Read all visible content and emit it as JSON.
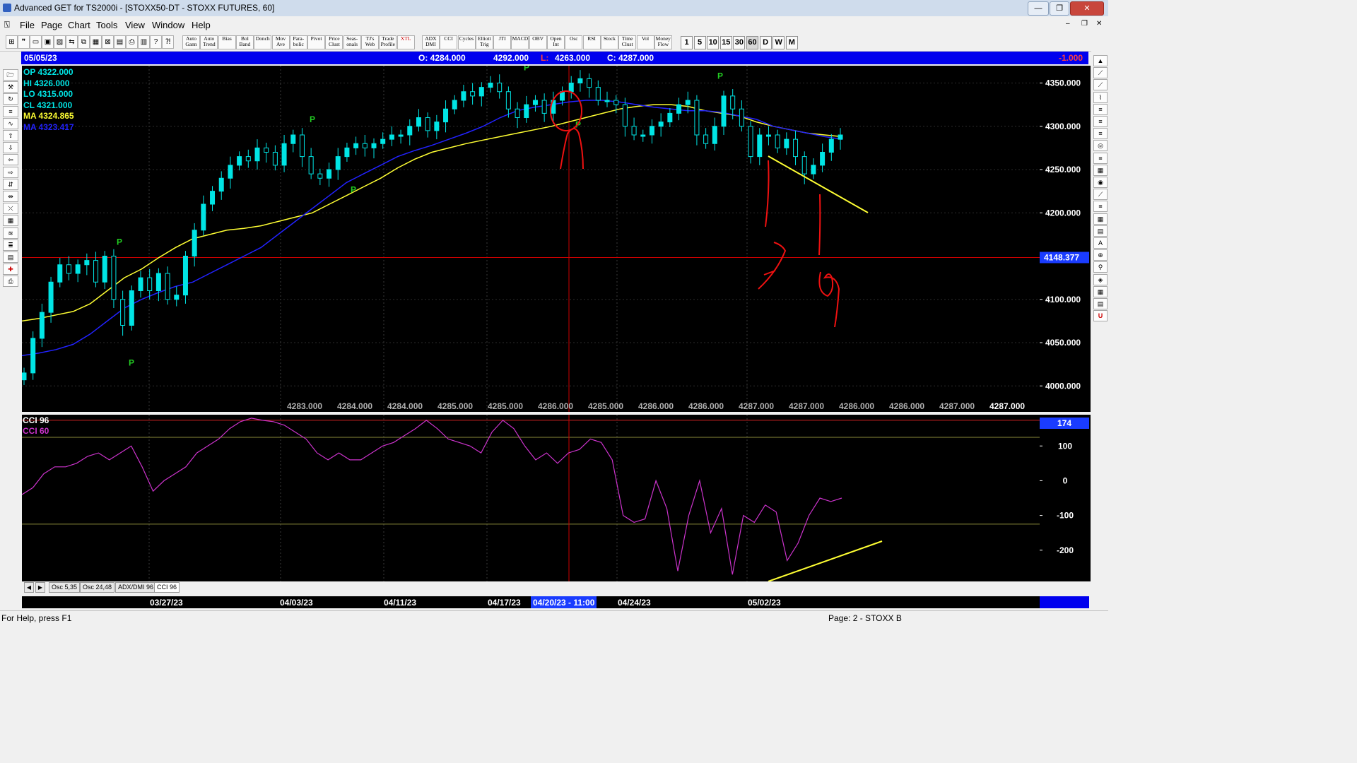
{
  "window": {
    "title": "Advanced GET for TS2000i - [STOXX50-DT - STOXX FUTURES, 60]",
    "min": "—",
    "max": "❐",
    "close": "✕"
  },
  "menu": [
    "File",
    "Page",
    "Chart",
    "Tools",
    "View",
    "Window",
    "Help"
  ],
  "toolbar": {
    "studies": [
      "Auto Gann",
      "Auto Trend",
      "Bias",
      "Bol Band",
      "Donch",
      "Mov Ave",
      "Para-bolic",
      "Pivot",
      "Price Clust",
      "Seas-onals",
      "TJ's Web",
      "Trade Profile",
      "XTL",
      "ADX DMI",
      "CCI",
      "Cycles",
      "Elliott Trig",
      "JTI",
      "MACD",
      "OBV",
      "Open Int",
      "Osc",
      "RSI",
      "Stock",
      "Time Clust",
      "Vol",
      "Money Flow"
    ],
    "intervals": [
      "1",
      "5",
      "10",
      "15",
      "30",
      "60",
      "D",
      "W",
      "M"
    ]
  },
  "header": {
    "date": "05/05/23",
    "open": "O: 4284.000",
    "high": "4292.000",
    "low_prefix": "L:",
    "low": "4263.000",
    "close": "C: 4287.000",
    "change": "-1.000"
  },
  "readout": {
    "op": "OP  4322.000",
    "hi": "HI   4326.000",
    "lo": "LO  4315.000",
    "cl": "CL  4321.000",
    "ma1": "MA  4324.865",
    "ma2": "MA  4323.417"
  },
  "price_axis": {
    "ticks": [
      "4350.000",
      "4300.000",
      "4250.000",
      "4200.000",
      "4100.000",
      "4050.000",
      "4000.000"
    ],
    "cursor_price": "4148.377"
  },
  "bottom_values": [
    "4283.000",
    "4284.000",
    "4284.000",
    "4285.000",
    "4285.000",
    "4286.000",
    "4285.000",
    "4286.000",
    "4286.000",
    "4287.000",
    "4287.000",
    "4286.000",
    "4286.000",
    "4287.000",
    "4287.000"
  ],
  "pivot_marker": "P",
  "osc": {
    "label1": "CCI 96",
    "label2": "CCI  60",
    "current": "174",
    "ticks": [
      "100",
      "0",
      "-100",
      "-200"
    ]
  },
  "tabs": [
    "Osc 5,35",
    "Osc 24,48",
    "ADX/DMI 96",
    "CCI 96"
  ],
  "dates": [
    "03/27/23",
    "04/03/23",
    "04/11/23",
    "04/17/23",
    "04/20/23 - 11:00",
    "04/24/23",
    "05/02/23"
  ],
  "status": {
    "help": "For Help, press F1",
    "page": "Page: 2 - STOXX B"
  },
  "colors": {
    "candle": "#00e5e5",
    "ma_yellow": "#ffff33",
    "ma_blue": "#2222ff",
    "cci": "#cc33cc",
    "cursor_line": "#cc0000",
    "annotation_red": "#ee1111",
    "trend_yellow": "#ffff33",
    "pivot_green": "#22cc22"
  },
  "chart_data": {
    "type": "line",
    "title": "STOXX50-DT - STOXX FUTURES, 60",
    "close_series": [
      4015,
      4055,
      4085,
      4120,
      4140,
      4130,
      4140,
      4145,
      4120,
      4150,
      4100,
      4070,
      4110,
      4125,
      4110,
      4130,
      4100,
      4105,
      4150,
      4180,
      4210,
      4225,
      4240,
      4255,
      4265,
      4260,
      4275,
      4270,
      4255,
      4280,
      4290,
      4265,
      4245,
      4240,
      4250,
      4265,
      4275,
      4280,
      4275,
      4280,
      4285,
      4290,
      4290,
      4300,
      4310,
      4295,
      4305,
      4320,
      4330,
      4340,
      4335,
      4345,
      4350,
      4340,
      4320,
      4310,
      4325,
      4330,
      4315,
      4330,
      4340,
      4350,
      4355,
      4345,
      4330,
      4330,
      4325,
      4300,
      4290,
      4290,
      4300,
      4305,
      4315,
      4325,
      4330,
      4290,
      4280,
      4300,
      4335,
      4320,
      4300,
      4265,
      4290,
      4290,
      4275,
      4285,
      4265,
      4245,
      4255,
      4270,
      4285,
      4290
    ],
    "ma_yellow": [
      4075,
      4078,
      4082,
      4086,
      4095,
      4110,
      4125,
      4135,
      4148,
      4160,
      4170,
      4175,
      4180,
      4182,
      4185,
      4190,
      4195,
      4200,
      4210,
      4220,
      4230,
      4240,
      4252,
      4262,
      4270,
      4275,
      4280,
      4284,
      4288,
      4292,
      4296,
      4300,
      4305,
      4310,
      4315,
      4320,
      4323,
      4325,
      4325,
      4323,
      4318,
      4315,
      4312,
      4305,
      4300,
      4296,
      4292,
      4290,
      4288
    ],
    "ma_blue": [
      4035,
      4038,
      4042,
      4048,
      4060,
      4075,
      4090,
      4100,
      4108,
      4115,
      4120,
      4130,
      4140,
      4150,
      4160,
      4175,
      4190,
      4205,
      4220,
      4235,
      4245,
      4255,
      4265,
      4272,
      4278,
      4285,
      4292,
      4300,
      4310,
      4318,
      4322,
      4325,
      4328,
      4330,
      4330,
      4328,
      4325,
      4322,
      4320,
      4318,
      4318,
      4316,
      4312,
      4308,
      4300,
      4296,
      4292,
      4288,
      4285
    ],
    "pivots": [
      {
        "x": "03/27/23",
        "y": 4158,
        "type": "high"
      },
      {
        "x": "03/27/23",
        "y": 4035,
        "type": "low"
      },
      {
        "x": "04/03/23",
        "y": 4300,
        "type": "high"
      },
      {
        "x": "04/05/23",
        "y": 4235,
        "type": "low"
      },
      {
        "x": "04/14/23",
        "y": 4360,
        "type": "high"
      },
      {
        "x": "04/20/23",
        "y": 4310,
        "type": "low"
      },
      {
        "x": "04/27/23",
        "y": 4350,
        "type": "high"
      }
    ],
    "cursor_date": "04/20/23 - 11:00",
    "cursor_price": 4148.377,
    "ylim": [
      3970,
      4370
    ],
    "cci": [
      -40,
      -20,
      20,
      40,
      40,
      50,
      70,
      80,
      60,
      80,
      100,
      40,
      -30,
      0,
      20,
      40,
      80,
      100,
      120,
      150,
      170,
      180,
      174,
      170,
      160,
      140,
      120,
      80,
      60,
      80,
      60,
      60,
      80,
      100,
      110,
      130,
      150,
      174,
      150,
      120,
      110,
      100,
      80,
      140,
      174,
      150,
      100,
      60,
      80,
      50,
      80,
      90,
      120,
      110,
      60,
      -100,
      -120,
      -110,
      0,
      -80,
      -260,
      -100,
      0,
      -150,
      -80,
      -270,
      -100,
      -120,
      -70,
      -90,
      -230,
      -180,
      -100,
      -50,
      -60,
      -50
    ],
    "cci_ylim": [
      -290,
      190
    ],
    "cci_levels": [
      174,
      125,
      -125
    ],
    "x_date_labels": [
      "03/27/23",
      "04/03/23",
      "04/11/23",
      "04/17/23",
      "04/20/23 - 11:00",
      "04/24/23",
      "05/02/23"
    ]
  }
}
